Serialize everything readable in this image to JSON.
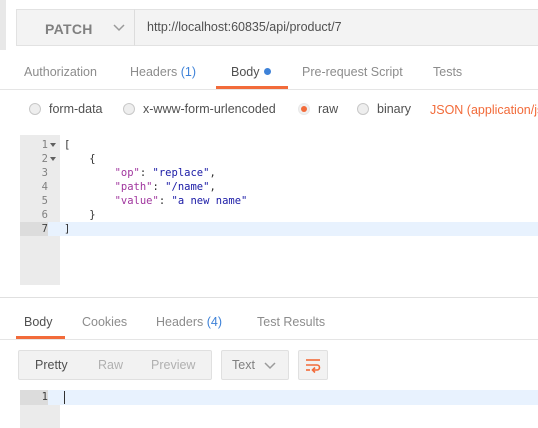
{
  "request": {
    "method": "PATCH",
    "url": "http://localhost:60835/api/product/7"
  },
  "request_tabs": [
    {
      "label": "Authorization"
    },
    {
      "label": "Headers",
      "count": "(1)"
    },
    {
      "label": "Body"
    },
    {
      "label": "Pre-request Script"
    },
    {
      "label": "Tests"
    }
  ],
  "body_types": [
    {
      "label": "form-data",
      "selected": false
    },
    {
      "label": "x-www-form-urlencoded",
      "selected": false
    },
    {
      "label": "raw",
      "selected": true
    },
    {
      "label": "binary",
      "selected": false
    }
  ],
  "content_type": "JSON (application/js",
  "editor": {
    "lines": [
      {
        "num": "1",
        "text": "["
      },
      {
        "num": "2",
        "text": "    {"
      },
      {
        "num": "3",
        "key": "\"op\"",
        "sep": ": ",
        "val": "\"replace\"",
        "end": ","
      },
      {
        "num": "4",
        "key": "\"path\"",
        "sep": ": ",
        "val": "\"/name\"",
        "end": ","
      },
      {
        "num": "5",
        "key": "\"value\"",
        "sep": ": ",
        "val": "\"a new name\"",
        "end": ""
      },
      {
        "num": "6",
        "text": "    }"
      },
      {
        "num": "7",
        "text": "]"
      }
    ]
  },
  "response_tabs": [
    {
      "label": "Body"
    },
    {
      "label": "Cookies"
    },
    {
      "label": "Headers",
      "count": "(4)"
    },
    {
      "label": "Test Results"
    }
  ],
  "response_format": {
    "options": [
      "Pretty",
      "Raw",
      "Preview"
    ],
    "type": "Text"
  },
  "response_editor": {
    "line_number": "1"
  },
  "colors": {
    "accent": "#f26b3a",
    "count_blue": "#3e82d8"
  }
}
